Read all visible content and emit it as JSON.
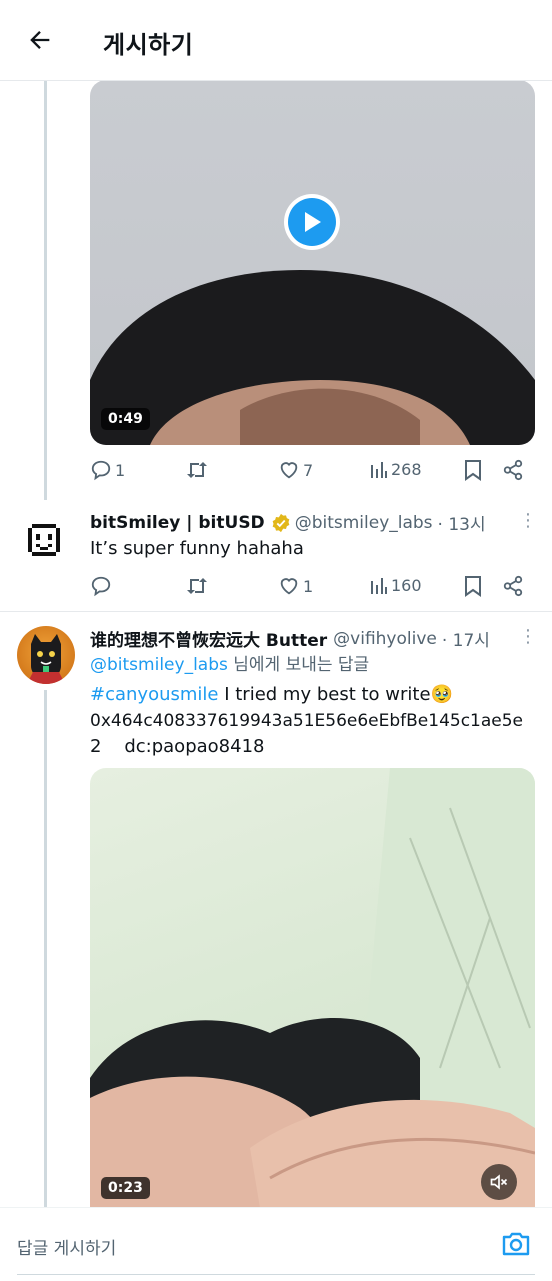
{
  "header": {
    "title": "게시하기"
  },
  "tweet1": {
    "video_duration": "0:49",
    "replies": "1",
    "likes": "7",
    "views": "268"
  },
  "tweet2": {
    "name": "bitSmiley | bitUSD",
    "handle": "@bitsmiley_labs",
    "time": "· 13시",
    "text": "It’s super funny hahaha",
    "likes": "1",
    "views": "160"
  },
  "tweet3": {
    "name": "谁的理想不曾恢宏远大 Butter",
    "handle": "@vifihyolive",
    "time": "· 17시",
    "reply_to_handle": "@bitsmiley_labs",
    "reply_to_suffix": "님에게 보내는 답글",
    "hashtag": "#canyousmile",
    "line1_text": "I tried my best to write🥹",
    "line2": "0x464c408337619943a51E56e6eEbfBe145c1ae5e",
    "line3": "2    dc:paopao8418",
    "video_duration": "0:23"
  },
  "reply_bar": {
    "placeholder": "답글 게시하기"
  },
  "colors": {
    "accent": "#1d9bf0",
    "muted": "#536471",
    "verified": "#e2b719"
  }
}
